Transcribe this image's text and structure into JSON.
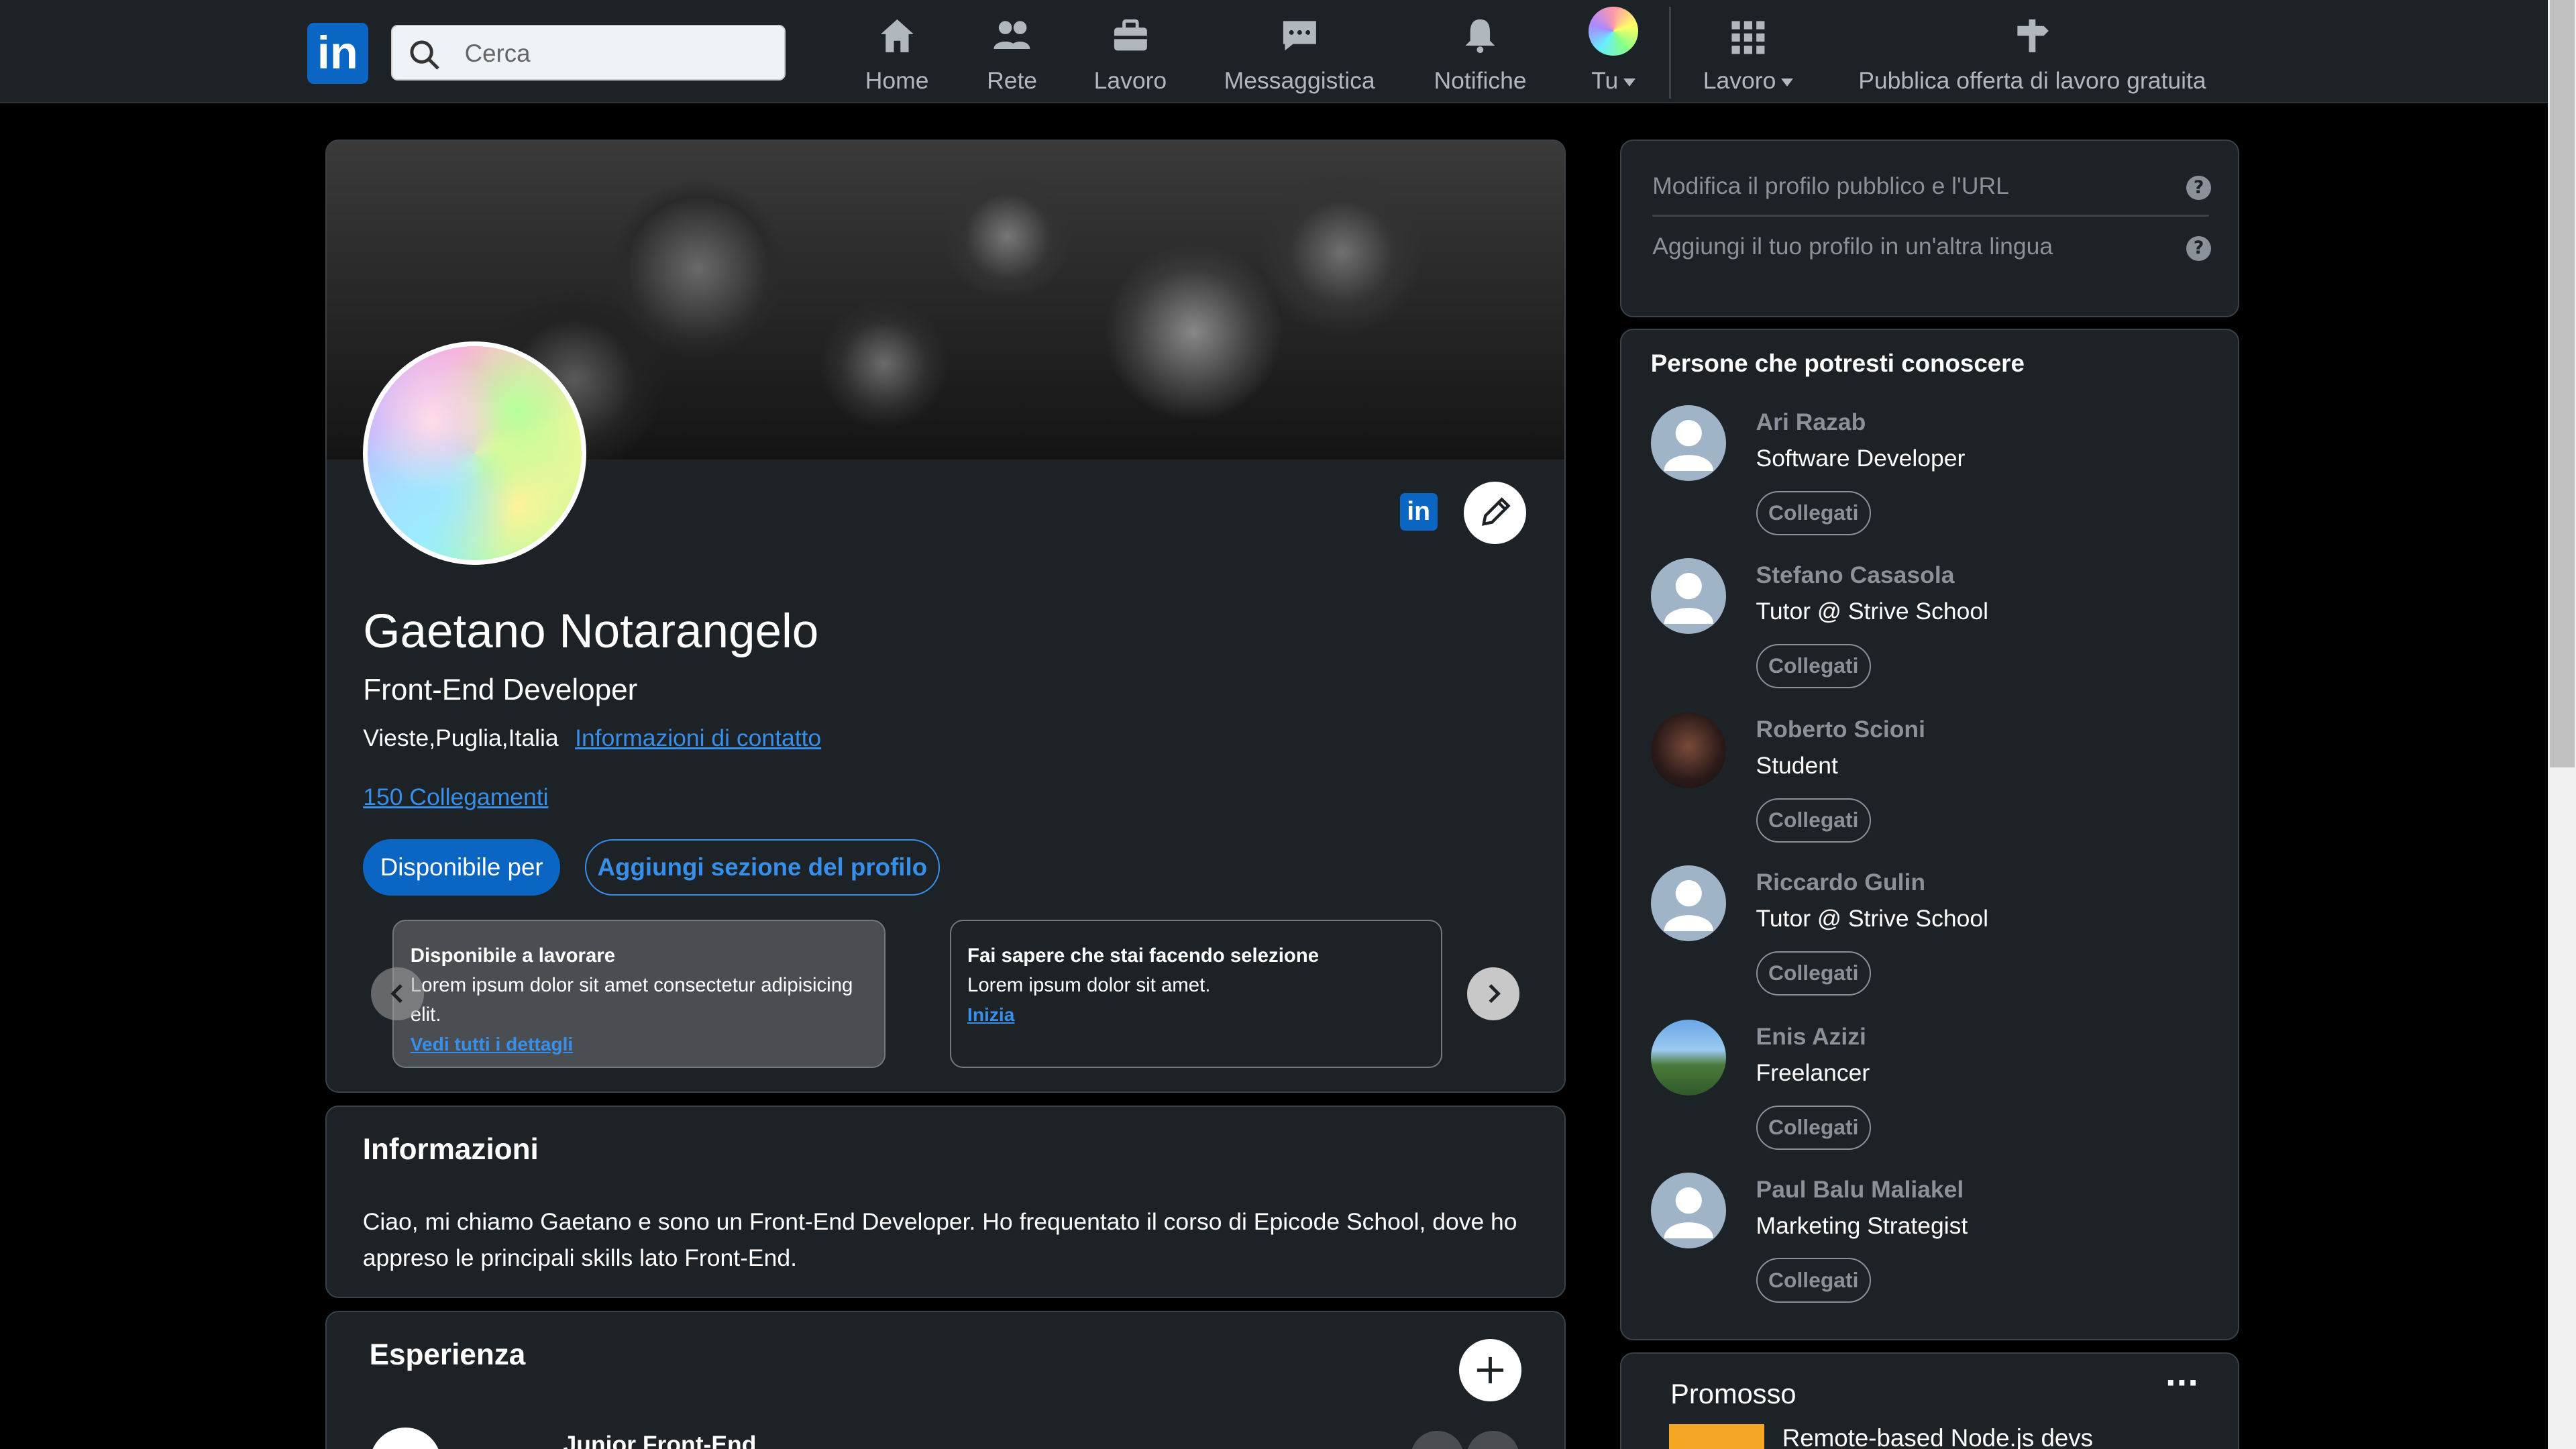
{
  "nav": {
    "logo": "in",
    "search_placeholder": "Cerca",
    "items": [
      {
        "label": "Home",
        "icon": "home-icon"
      },
      {
        "label": "Rete",
        "icon": "network-icon"
      },
      {
        "label": "Lavoro",
        "icon": "briefcase-icon"
      },
      {
        "label": "Messaggistica",
        "icon": "message-icon"
      },
      {
        "label": "Notifiche",
        "icon": "bell-icon"
      },
      {
        "label": "Tu",
        "icon": "avatar"
      },
      {
        "label": "Lavoro",
        "icon": "grid-icon"
      },
      {
        "label": "Pubblica offerta di lavoro gratuita",
        "icon": "post-job-icon"
      }
    ]
  },
  "profile": {
    "name": "Gaetano Notarangelo",
    "headline": "Front-End Developer",
    "location": "Vieste,Puglia,Italia",
    "contact_link": "Informazioni di contatto",
    "connections": "150 Collegamenti",
    "badge": "in",
    "btn_available": "Disponibile per",
    "btn_add_section": "Aggiungi sezione del profilo",
    "cards": [
      {
        "title": "Disponibile a lavorare",
        "text": "Lorem ipsum dolor sit amet consectetur adipisicing elit.",
        "link": "Vedi tutti i dettagli"
      },
      {
        "title": "Fai sapere che stai facendo selezione",
        "text": "Lorem ipsum dolor sit amet.",
        "link": "Inizia"
      }
    ]
  },
  "about": {
    "title": "Informazioni",
    "text": "Ciao, mi chiamo Gaetano e sono un Front-End Developer. Ho frequentato il corso di Epicode School, dove ho appreso le principali skills lato Front-End."
  },
  "experience": {
    "title": "Esperienza",
    "first_item": "Junior Front-End"
  },
  "sidebar": {
    "links": [
      "Modifica il profilo pubblico e l'URL",
      "Aggiungi il tuo profilo in un'altra lingua"
    ],
    "help": "?",
    "people_title": "Persone che potresti conoscere",
    "connect_label": "Collegati",
    "people": [
      {
        "name": "Ari Razab",
        "role": "Software Developer"
      },
      {
        "name": "Stefano Casasola",
        "role": "Tutor @ Strive School"
      },
      {
        "name": "Roberto Scioni",
        "role": "Student"
      },
      {
        "name": "Riccardo Gulin",
        "role": "Tutor @ Strive School"
      },
      {
        "name": "Enis Azizi",
        "role": "Freelancer"
      },
      {
        "name": "Paul Balu Maliakel",
        "role": "Marketing Strategist"
      }
    ],
    "promo_title": "Promosso",
    "promo_more": "···",
    "promo_item": "Remote-based Node.js devs"
  },
  "colors": {
    "accent": "#0a66c2",
    "link": "#378fe9",
    "card_bg": "#1d2226"
  }
}
